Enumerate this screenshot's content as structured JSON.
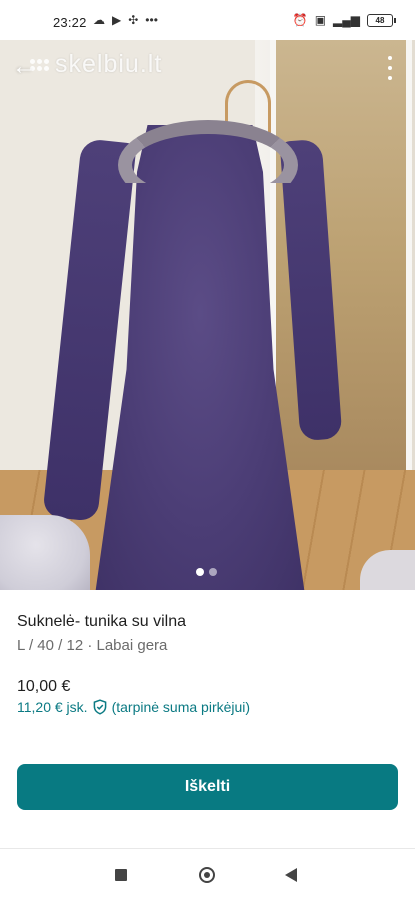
{
  "status_bar": {
    "time": "23:22",
    "battery": "48",
    "left_icons": [
      "cloud-icon",
      "youtube-icon",
      "grid-icon",
      "more-icon"
    ],
    "right_icons": [
      "alarm-icon",
      "volte-icon",
      "signal-icon",
      "battery-icon"
    ]
  },
  "photo": {
    "watermark": "skelbiu.lt",
    "page_count": 2,
    "active_page": 1
  },
  "listing": {
    "title": "Suknelė- tunika su vilna",
    "details": "L / 40 / 12 · Labai gera",
    "price": "10,00 €",
    "price_with_fee": "11,20 € jsk.",
    "fee_note": "(tarpinė suma pirkėjui)"
  },
  "cta": {
    "label": "Iškelti"
  },
  "colors": {
    "accent": "#087a82",
    "accent_text": "#0b7a83"
  },
  "navbar": {
    "icons": [
      "recent-apps-icon",
      "home-icon",
      "back-icon"
    ]
  }
}
